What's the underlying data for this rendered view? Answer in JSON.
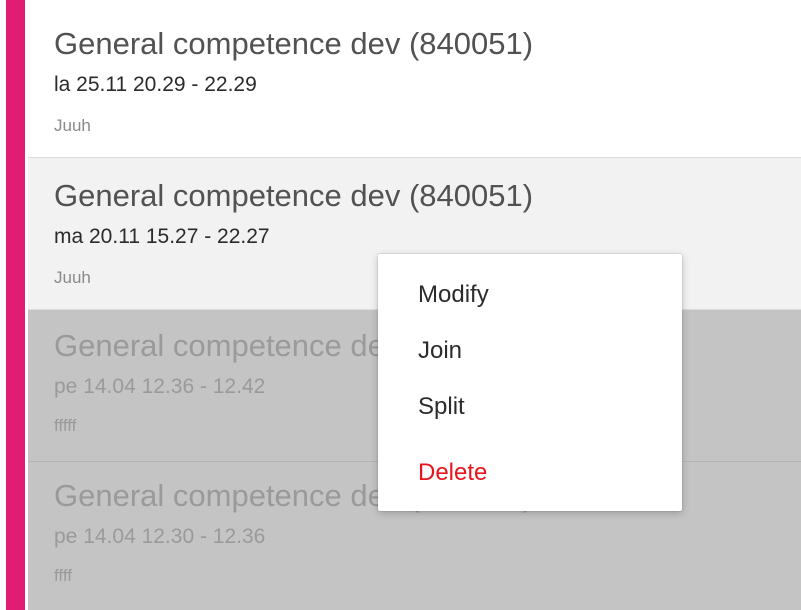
{
  "entries": [
    {
      "title": "General competence dev (840051)",
      "time": "la 25.11 20.29 - 22.29",
      "note": "Juuh"
    },
    {
      "title": "General competence dev (840051)",
      "time": "ma 20.11 15.27 - 22.27",
      "note": "Juuh"
    },
    {
      "title": "General competence dev (840051)",
      "time": "pe 14.04 12.36 - 12.42",
      "note": "fffff"
    },
    {
      "title": "General competence dev (840051)",
      "time": "pe 14.04 12.30 - 12.36",
      "note": "ffff"
    }
  ],
  "context_menu": {
    "modify": "Modify",
    "join": "Join",
    "split": "Split",
    "delete": "Delete"
  },
  "colors": {
    "accent": "#e11c74",
    "delete": "#e8151b",
    "selected_background": "#f2f2f2",
    "disabled_background": "#c4c4c4"
  }
}
